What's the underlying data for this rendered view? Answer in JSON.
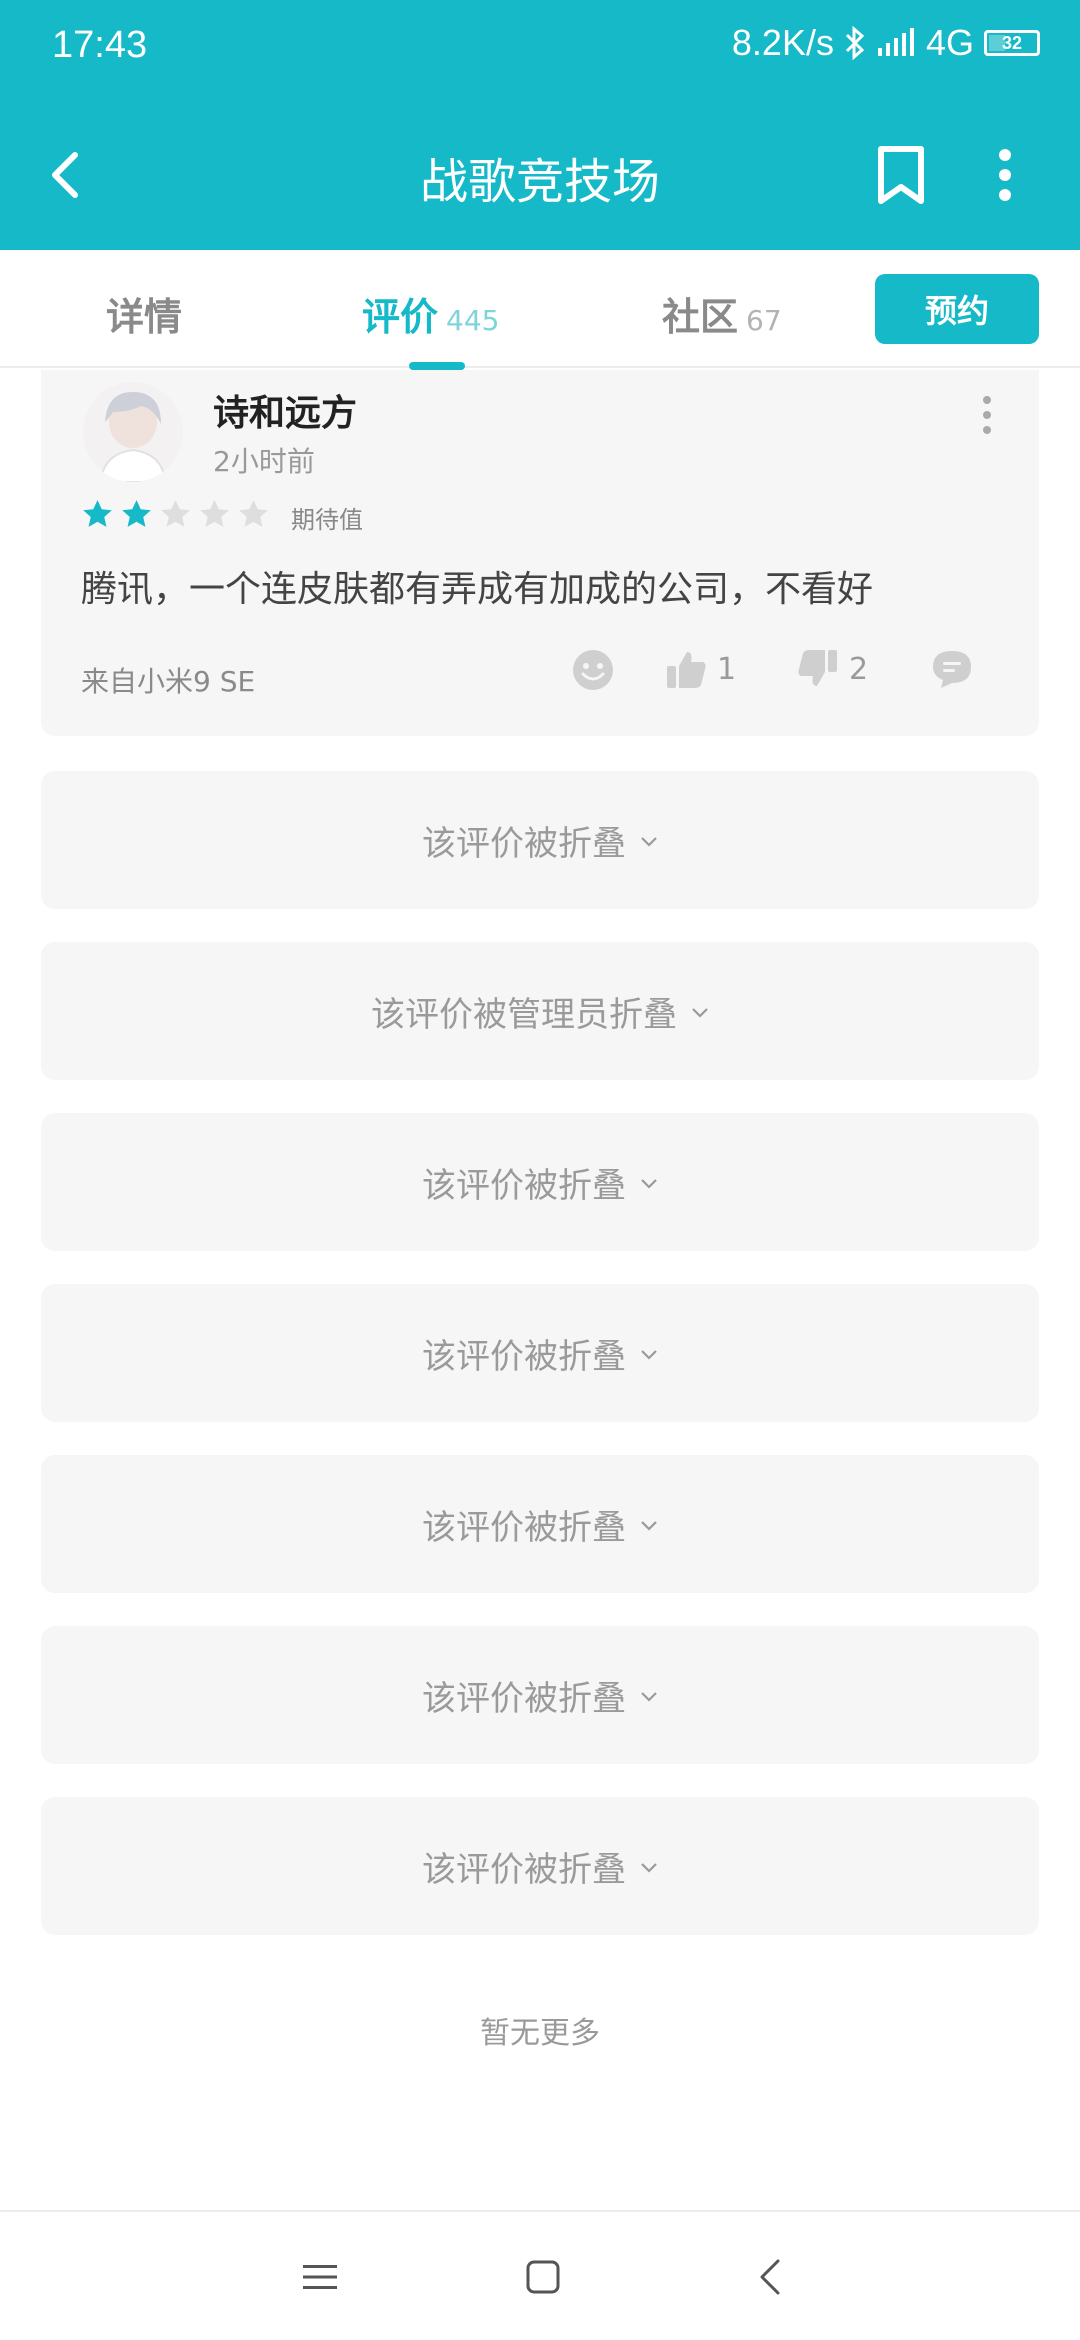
{
  "status_bar": {
    "time": "17:43",
    "network_speed": "8.2K/s",
    "network_type": "4G",
    "battery_level": "32",
    "icons": [
      "bluetooth-icon",
      "signal-icon",
      "battery-icon"
    ]
  },
  "app_bar": {
    "title": "战歌竞技场",
    "icons": [
      "back-arrow-icon",
      "bookmark-icon",
      "more-vertical-icon"
    ]
  },
  "tabs": [
    {
      "label": "详情",
      "count": ""
    },
    {
      "label": "评价",
      "count": "445",
      "active": true
    },
    {
      "label": "社区",
      "count": "67"
    }
  ],
  "reserve_button": "预约",
  "review": {
    "username": "诗和远方",
    "time": "2小时前",
    "rating": 2,
    "rating_max": 5,
    "rating_label": "期待值",
    "text": "腾讯，一个连皮肤都有弄成有加成的公司，不看好",
    "device": "来自小米9 SE",
    "likes": "1",
    "dislikes": "2",
    "icons": [
      "emoji-icon",
      "thumb-up-icon",
      "thumb-down-icon",
      "comment-icon"
    ]
  },
  "folded_reviews": [
    "该评价被折叠",
    "该评价被管理员折叠",
    "该评价被折叠",
    "该评价被折叠",
    "该评价被折叠",
    "该评价被折叠",
    "该评价被折叠"
  ],
  "no_more_text": "暂无更多",
  "nav_bar": {
    "icons": [
      "menu-icon",
      "home-square-icon",
      "back-icon"
    ]
  },
  "colors": {
    "accent": "#15b9c8",
    "card_bg": "#f6f6f6",
    "muted_text": "#9a9a9a"
  }
}
